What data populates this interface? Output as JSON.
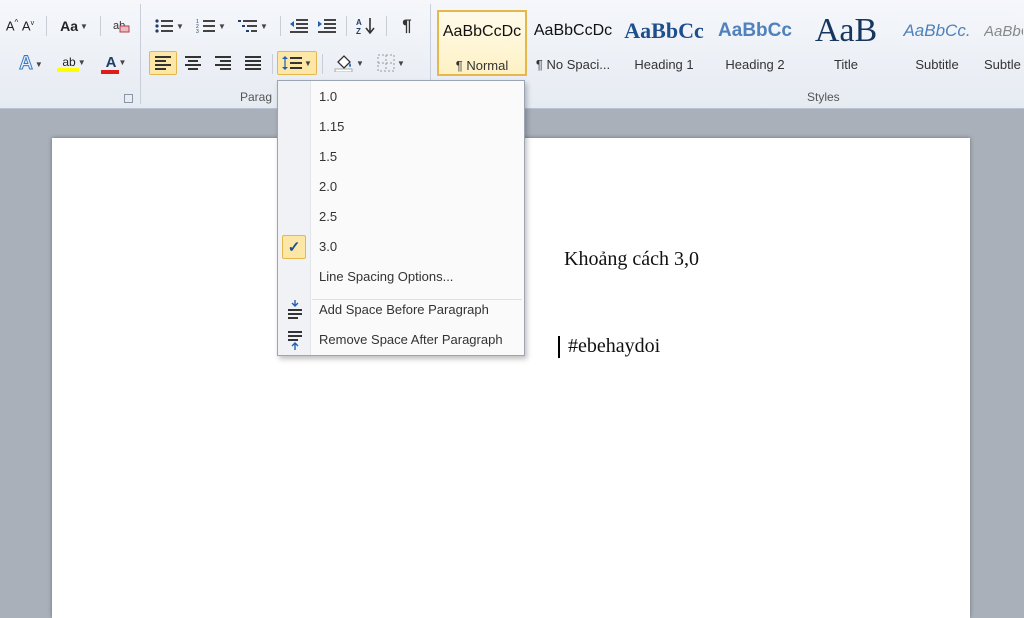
{
  "ribbon": {
    "paragraph_group_label": "Parag",
    "styles_group_label": "Styles",
    "grow_font_icon": "grow-font",
    "change_case_label": "Aa",
    "font_color_letter": "A",
    "text_effects_letter": "A",
    "highlight_letters": "ab",
    "show_formatting_glyph": "¶",
    "accent_yellow": "#fce7a7",
    "accent_border": "#e6b84c"
  },
  "styles": [
    {
      "preview": "AaBbCcDc",
      "name": "¶ Normal",
      "selected": true
    },
    {
      "preview": "AaBbCcDc",
      "name": "¶ No Spaci...",
      "selected": false
    },
    {
      "preview": "AaBbCc",
      "name": "Heading 1",
      "selected": false
    },
    {
      "preview": "AaBbCc",
      "name": "Heading 2",
      "selected": false
    },
    {
      "preview": "AaB",
      "name": "Title",
      "selected": false
    },
    {
      "preview": "AaBbCc.",
      "name": "Subtitle",
      "selected": false
    },
    {
      "preview": "AaBbC",
      "name": "Subtle",
      "selected": false
    }
  ],
  "menu": {
    "spacing_options": [
      {
        "label": "1.0",
        "checked": false
      },
      {
        "label": "1.15",
        "checked": false
      },
      {
        "label": "1.5",
        "checked": false
      },
      {
        "label": "2.0",
        "checked": false
      },
      {
        "label": "2.5",
        "checked": false
      },
      {
        "label": "3.0",
        "checked": true
      }
    ],
    "line_spacing_options_label": "Line Spacing Options...",
    "add_space_before_label": "Add Space Before Paragraph",
    "remove_space_after_label": "Remove Space After Paragraph",
    "checkmark": "✓"
  },
  "document": {
    "line1": "Khoảng cách 3,0",
    "line2": "#ebehaydoi"
  }
}
